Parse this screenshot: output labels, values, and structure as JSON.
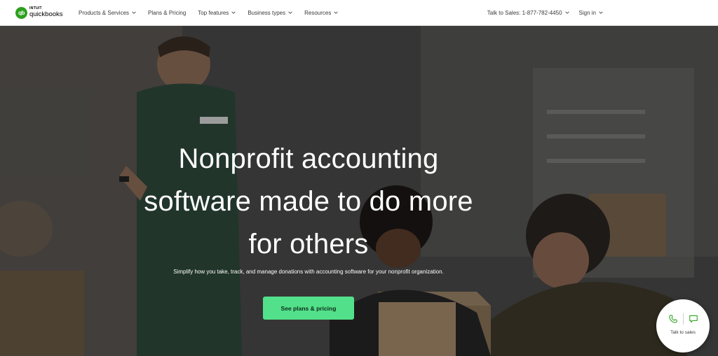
{
  "header": {
    "logo": {
      "brand": "INTUIT",
      "name": "quickbooks",
      "mark": "qb"
    },
    "nav": [
      {
        "label": "Products & Services",
        "dropdown": true
      },
      {
        "label": "Plans & Pricing",
        "dropdown": false
      },
      {
        "label": "Top features",
        "dropdown": true
      },
      {
        "label": "Business types",
        "dropdown": true
      },
      {
        "label": "Resources",
        "dropdown": true
      }
    ],
    "sales": "Talk to Sales: 1-877-782-4450",
    "signin": "Sign in"
  },
  "hero": {
    "headline_1": "Nonprofit accounting",
    "headline_2": "software made to do more",
    "headline_3": "for others",
    "subtitle": "Simplify how you take, track, and manage donations with accounting software for your nonprofit organization.",
    "cta": "See plans & pricing"
  },
  "chat": {
    "label": "Talk to sales"
  },
  "colors": {
    "brand_green": "#2ca01c",
    "cta_green": "#53e08b",
    "text": "#393a3d"
  }
}
